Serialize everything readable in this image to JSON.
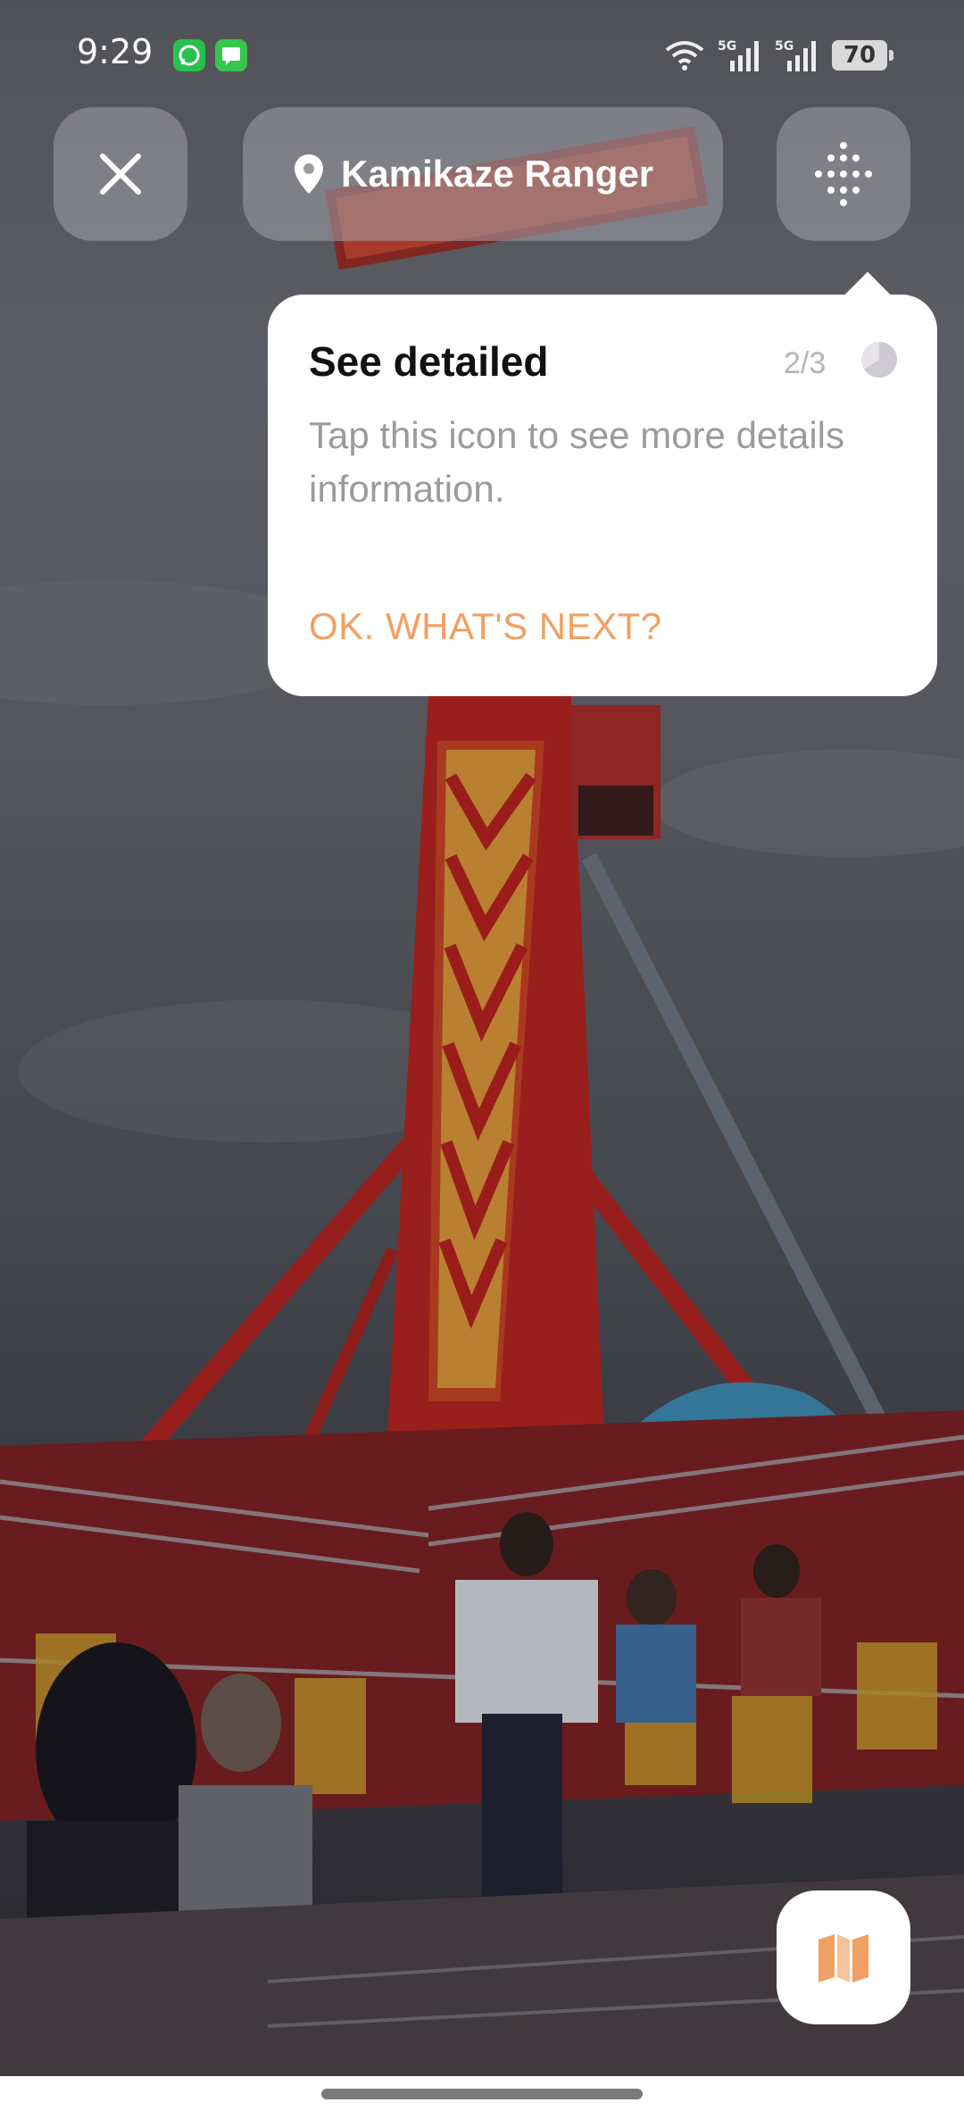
{
  "status_bar": {
    "time": "9:29",
    "battery": "70",
    "network_label": "5G"
  },
  "top_bar": {
    "location_name": "Kamikaze Ranger"
  },
  "tooltip": {
    "title": "See detailed",
    "step": "2/3",
    "description": "Tap this icon to see more details information.",
    "action": "OK. WHAT'S NEXT?",
    "progress_fraction": 0.66
  },
  "colors": {
    "accent": "#f0a063",
    "pill_bg": "#9c9ca6",
    "tooltip_bg": "#ffffff"
  }
}
